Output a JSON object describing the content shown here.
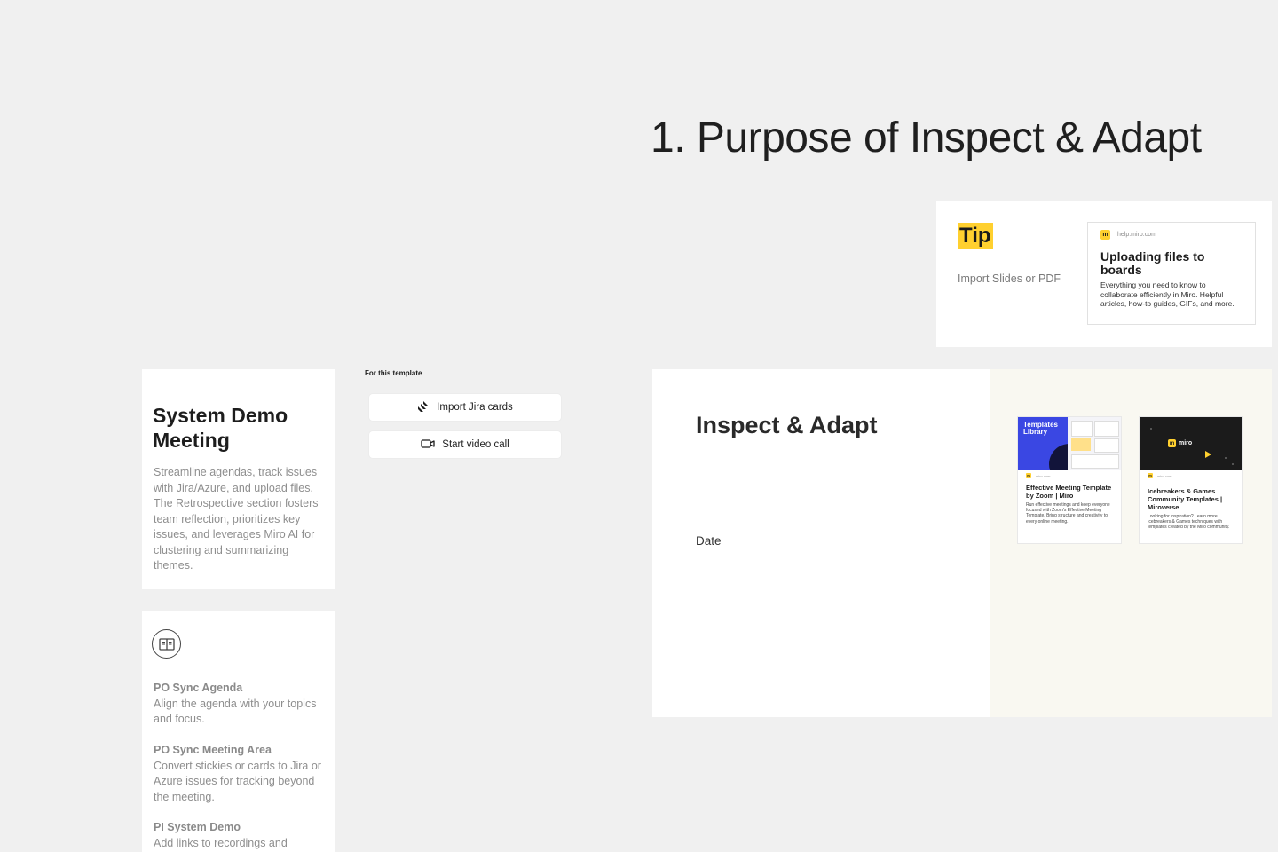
{
  "section": {
    "title": "1. Purpose of Inspect & Adapt"
  },
  "tip": {
    "label": "Tip",
    "text": "Import Slides or PDF",
    "link": {
      "source": "help.miro.com",
      "title": "Uploading files to boards",
      "description": "Everything you need to know to collaborate efficiently in Miro. Helpful articles, how-to guides, GIFs, and more."
    }
  },
  "system_demo": {
    "title": "System Demo Meeting",
    "description": "Streamline agendas, track issues with Jira/Azure, and upload files. The Retrospective section fosters team reflection, prioritizes key issues, and leverages Miro AI for clustering and summarizing themes."
  },
  "agenda": {
    "icon": "book-open-icon",
    "items": [
      {
        "heading": "PO Sync Agenda",
        "text": "Align the agenda with your topics and focus."
      },
      {
        "heading": "PO Sync Meeting Area",
        "text": "Convert stickies or cards to Jira or Azure issues for tracking beyond the meeting."
      },
      {
        "heading": "PI System Demo",
        "text": "Add links to recordings and"
      }
    ]
  },
  "template_actions": {
    "label": "For this template",
    "buttons": [
      {
        "label": "Import Jira cards",
        "icon": "jira-icon"
      },
      {
        "label": "Start video call",
        "icon": "video-camera-icon"
      }
    ]
  },
  "inspect_adapt": {
    "title": "Inspect & Adapt",
    "date_label": "Date",
    "cards": [
      {
        "thumb_text": "Templates Library",
        "source": "miro.com",
        "title": "Effective Meeting Template by Zoom | Miro",
        "description": "Run effective meetings and keep everyone focused with Zoom's Effective Meeting Template. Bring structure and creativity to every online meeting."
      },
      {
        "thumb_text": "miro",
        "source": "miro.com",
        "title": "Icebreakers & Games Community Templates | Miroverse",
        "description": "Looking for inspiration? Learn more Icebreakers & Games techniques with templates created by the Miro community."
      }
    ]
  },
  "colors": {
    "canvas": "#f0f0f0",
    "tip_highlight": "#ffd02f",
    "miro_yellow": "#ffd02f",
    "templates_blue": "#3a47e3",
    "miroverse_dark": "#1b1b1b"
  }
}
